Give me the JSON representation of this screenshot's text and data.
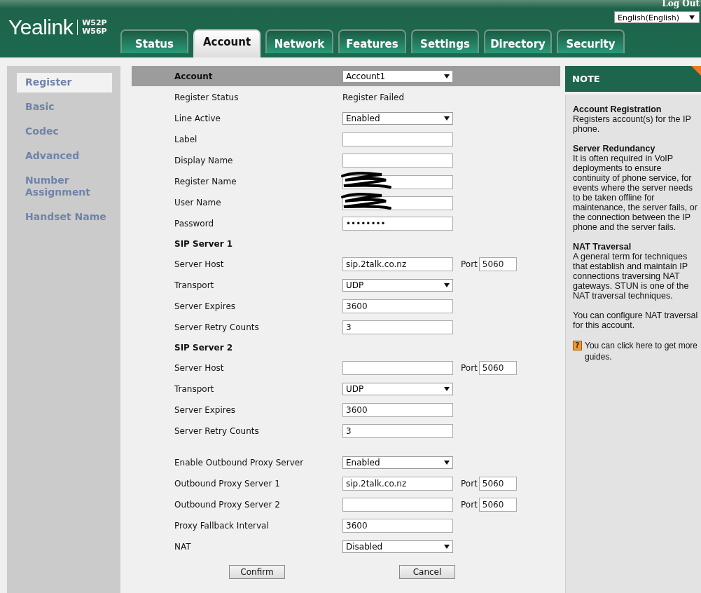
{
  "header": {
    "logo": "Yealink",
    "models": [
      "W52P",
      "W56P"
    ],
    "logout": "Log Out",
    "language": "English(English)"
  },
  "tabs": [
    {
      "label": "Status",
      "selected": false
    },
    {
      "label": "Account",
      "selected": true
    },
    {
      "label": "Network",
      "selected": false
    },
    {
      "label": "Features",
      "selected": false
    },
    {
      "label": "Settings",
      "selected": false
    },
    {
      "label": "Directory",
      "selected": false
    },
    {
      "label": "Security",
      "selected": false
    }
  ],
  "sidebar": {
    "items": [
      {
        "label": "Register",
        "selected": true
      },
      {
        "label": "Basic",
        "selected": false
      },
      {
        "label": "Codec",
        "selected": false
      },
      {
        "label": "Advanced",
        "selected": false
      },
      {
        "label": "Number Assignment",
        "selected": false
      },
      {
        "label": "Handset Name",
        "selected": false
      }
    ]
  },
  "form": {
    "rows": [
      {
        "kind": "header",
        "label": "Account",
        "value": "Account1"
      },
      {
        "kind": "text",
        "label": "Register Status",
        "value": "Register Failed"
      },
      {
        "kind": "select",
        "label": "Line Active",
        "value": "Enabled"
      },
      {
        "kind": "input",
        "label": "Label"
      },
      {
        "kind": "input",
        "label": "Display Name"
      },
      {
        "kind": "redacted",
        "label": "Register Name"
      },
      {
        "kind": "redacted",
        "label": "User Name"
      },
      {
        "kind": "input",
        "label": "Password",
        "value": "••••••••"
      },
      {
        "kind": "section",
        "label": "SIP Server 1"
      },
      {
        "kind": "input",
        "label": "Server Host",
        "value": "sip.2talk.co.nz",
        "port_label": "Port",
        "port": "5060"
      },
      {
        "kind": "select",
        "label": "Transport",
        "value": "UDP"
      },
      {
        "kind": "input",
        "label": "Server Expires",
        "value": "3600"
      },
      {
        "kind": "input",
        "label": "Server Retry Counts",
        "value": "3"
      },
      {
        "kind": "section",
        "label": "SIP Server 2"
      },
      {
        "kind": "input",
        "label": "Server Host",
        "port_label": "Port",
        "port": "5060"
      },
      {
        "kind": "select",
        "label": "Transport",
        "value": "UDP"
      },
      {
        "kind": "input",
        "label": "Server Expires",
        "value": "3600"
      },
      {
        "kind": "input",
        "label": "Server Retry Counts",
        "value": "3"
      },
      {
        "kind": "select",
        "label": "Enable Outbound Proxy Server",
        "value": "Enabled",
        "gap_before": true
      },
      {
        "kind": "input",
        "label": "Outbound Proxy Server 1",
        "value": "sip.2talk.co.nz",
        "port_label": "Port",
        "port": "5060"
      },
      {
        "kind": "input",
        "label": "Outbound Proxy Server 2",
        "port_label": "Port",
        "port": "5060"
      },
      {
        "kind": "input",
        "label": "Proxy Fallback Interval",
        "value": "3600"
      },
      {
        "kind": "select",
        "label": "NAT",
        "value": "Disabled"
      }
    ],
    "buttons": [
      "Confirm",
      "Cancel"
    ]
  },
  "note": {
    "title": "NOTE",
    "sections": [
      {
        "heading": "Account Registration",
        "text": "Registers account(s) for the IP phone."
      },
      {
        "heading": "Server Redundancy",
        "text": "It is often required in VoIP deployments to ensure continuity of phone service, for events where the server needs to be taken offline for maintenance, the server fails, or the connection between the IP phone and the server fails."
      },
      {
        "heading": "NAT Traversal",
        "text": "A general term for techniques that establish and maintain IP connections traversing NAT gateways. STUN is one of the NAT traversal techniques."
      }
    ],
    "extra": "You can configure NAT traversal for this account.",
    "guide_icon": "?",
    "guide": "You can click here to get more guides."
  }
}
